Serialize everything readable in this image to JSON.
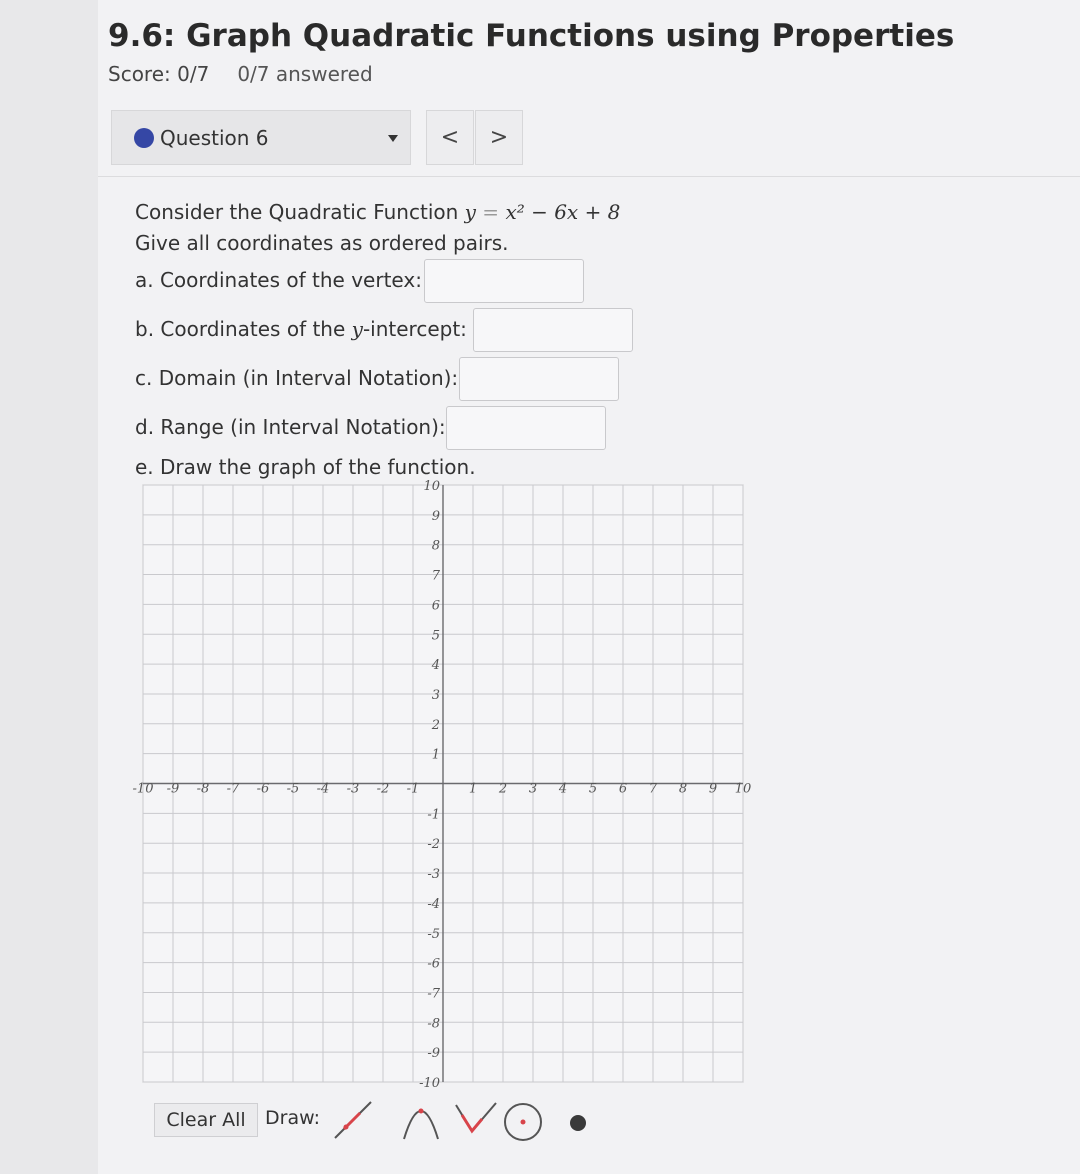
{
  "header": {
    "title": "9.6: Graph Quadratic Functions using Properties",
    "score": "Score: 0/7",
    "answered": "0/7 answered"
  },
  "question_nav": {
    "label": "Question 6",
    "prev": "<",
    "next": ">"
  },
  "question": {
    "prompt_text": "Consider the Quadratic Function ",
    "function_lhs": "y",
    "function_rhs": "x² − 6x + 8",
    "instructions": "Give all coordinates as ordered pairs.",
    "parts": [
      {
        "prefix": "a. Coordinates of the vertex:",
        "value": ""
      },
      {
        "prefix": "b. Coordinates of the ",
        "var": "y",
        "suffix": "-intercept:",
        "value": ""
      },
      {
        "prefix": "c. Domain (in Interval Notation):",
        "value": ""
      },
      {
        "prefix": "d. Range (in Interval Notation):",
        "value": ""
      }
    ],
    "graph_instruction": "e. Draw the graph of the function."
  },
  "graph": {
    "x_range": [
      -10,
      10
    ],
    "y_range": [
      -10,
      10
    ],
    "x_ticks": [
      -10,
      -9,
      -8,
      -7,
      -6,
      -5,
      -4,
      -3,
      -2,
      -1,
      1,
      2,
      3,
      4,
      5,
      6,
      7,
      8,
      9,
      10
    ],
    "y_ticks": [
      10,
      9,
      8,
      7,
      6,
      5,
      4,
      3,
      2,
      1,
      -1,
      -2,
      -3,
      -4,
      -5,
      -6,
      -7,
      -8,
      -9,
      -10
    ]
  },
  "toolbar": {
    "clear_label": "Clear All",
    "draw_label": "Draw:",
    "tools": [
      "line-tool-icon",
      "parabola-tool-icon",
      "vee-tool-icon",
      "circle-tool-icon",
      "point-tool-icon"
    ]
  },
  "colors": {
    "accent_dot": "#3547a5",
    "tool_red": "#d8444a"
  }
}
